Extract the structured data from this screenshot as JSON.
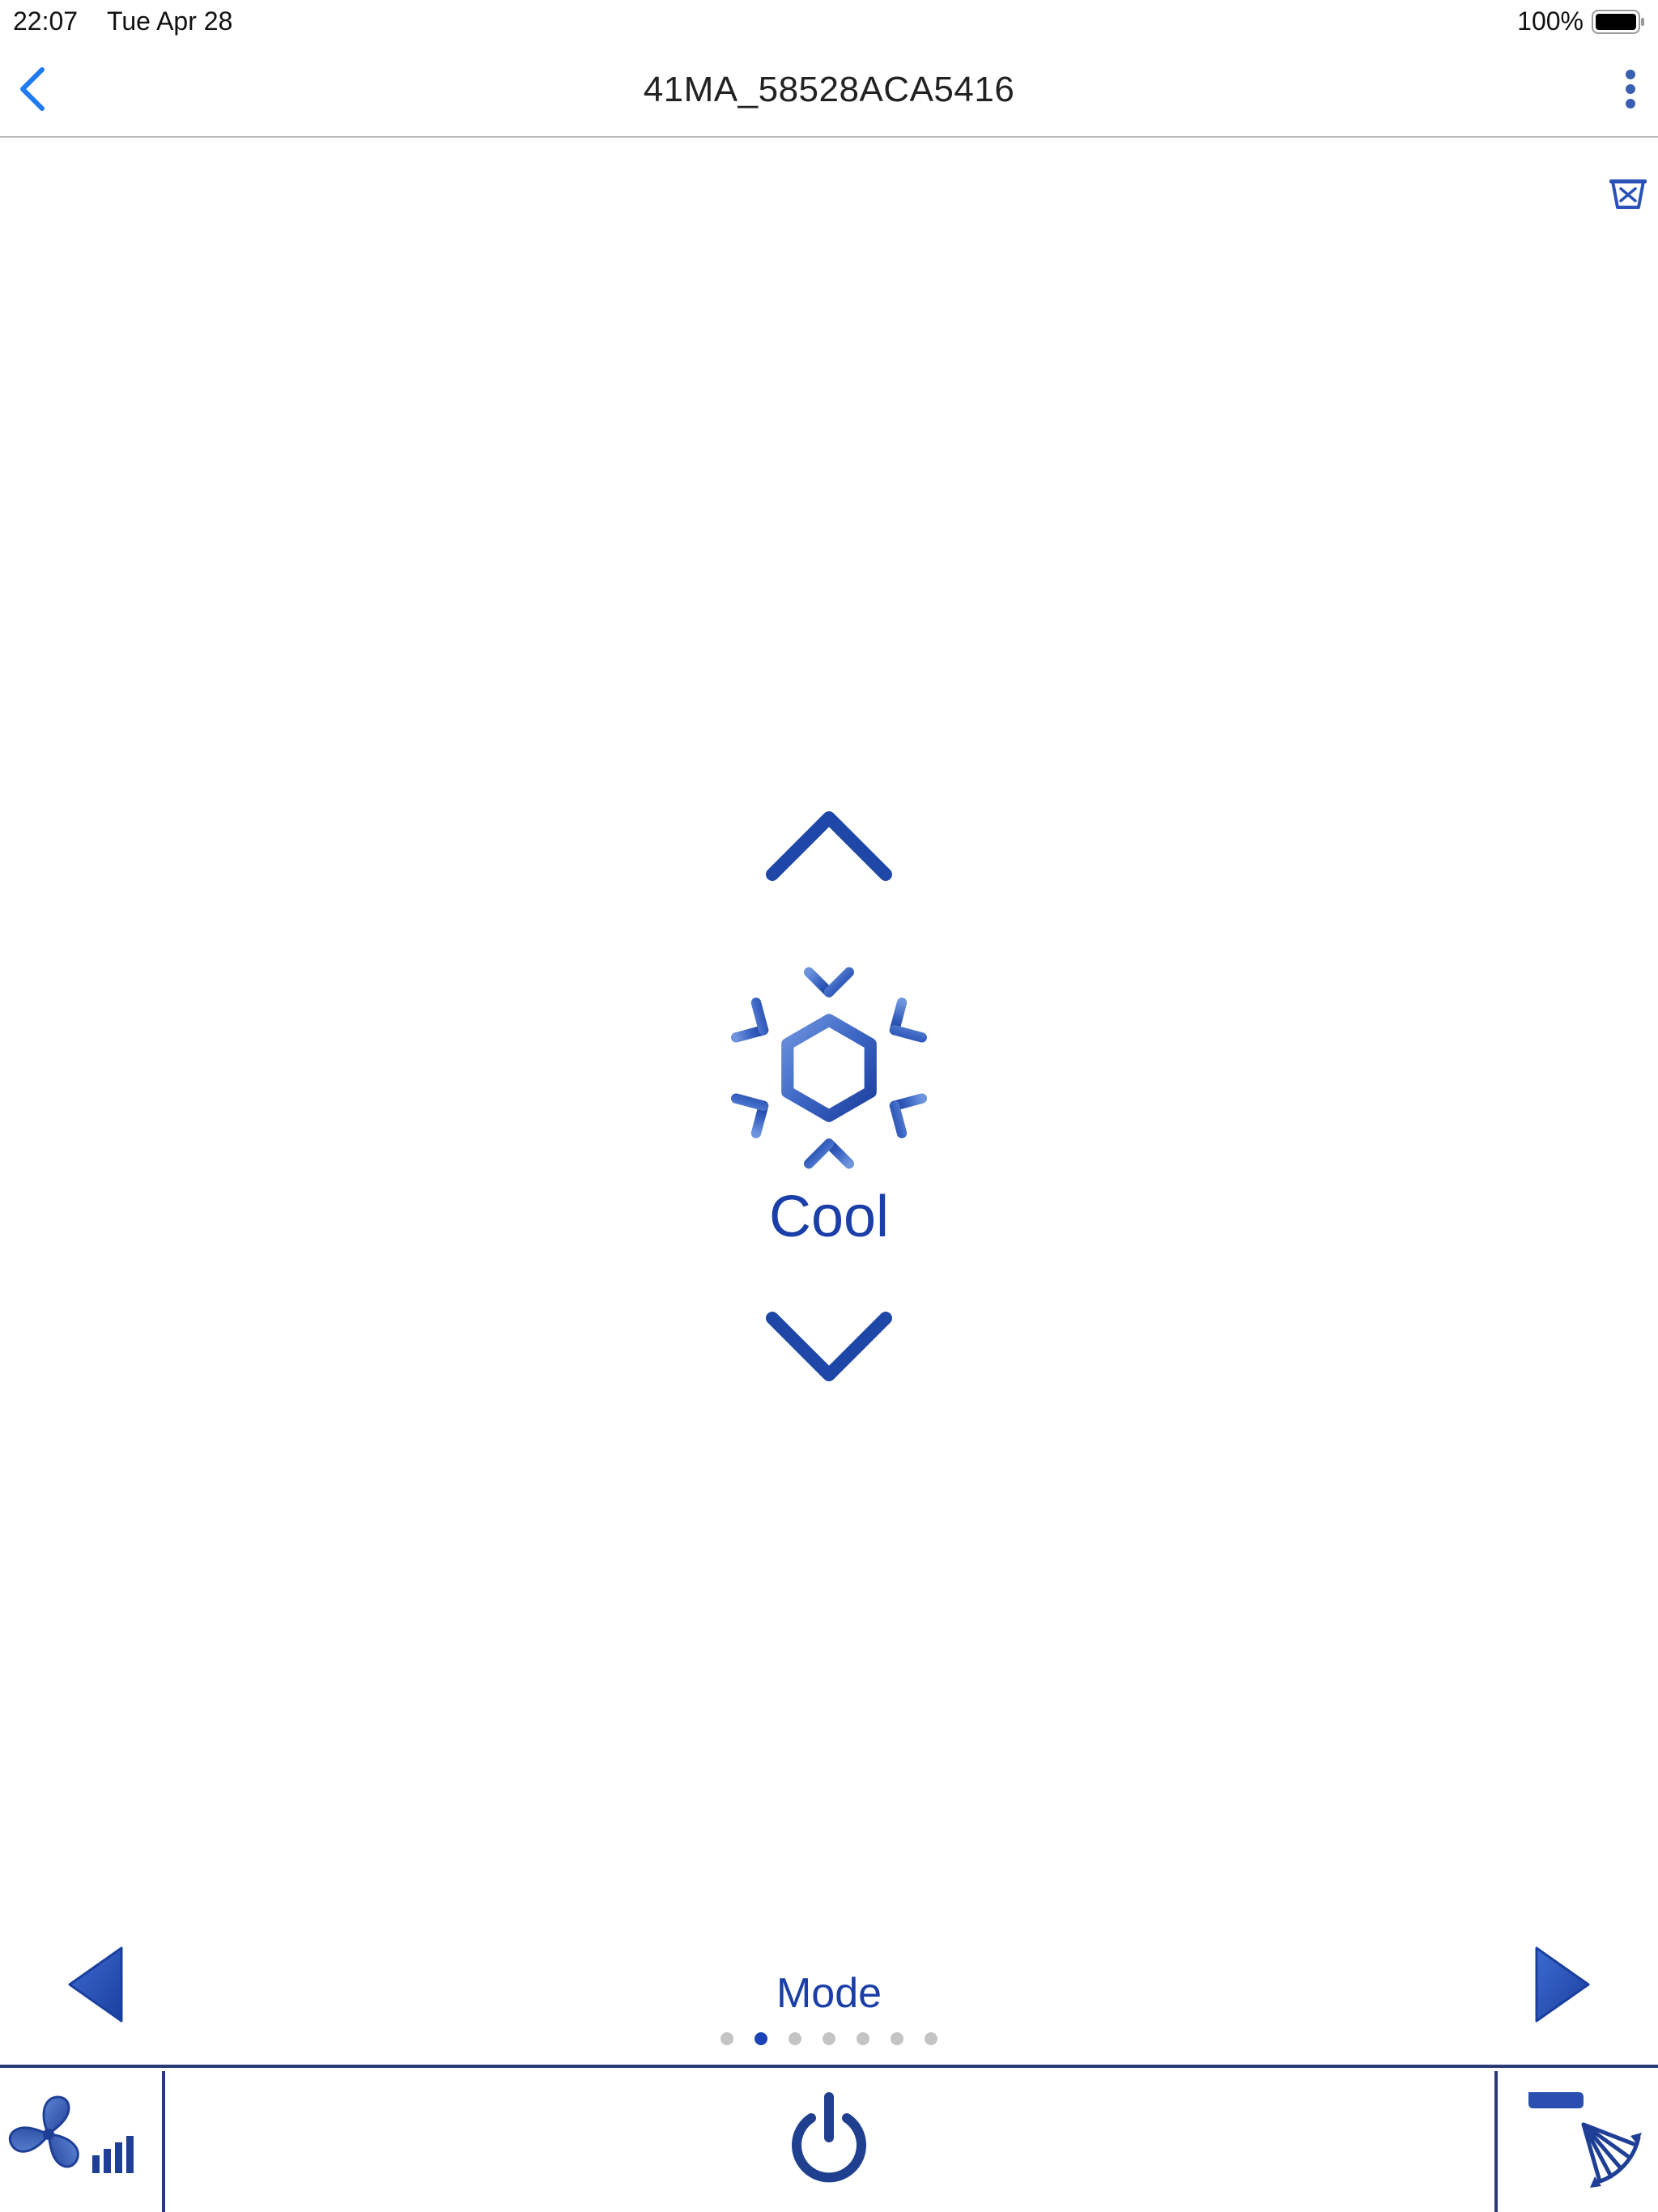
{
  "status_bar": {
    "time": "22:07",
    "date": "Tue Apr 28",
    "battery_text": "100%",
    "battery_level": 1.0
  },
  "nav": {
    "title": "41MA_58528ACA5416",
    "back_icon": "chevron-left-icon",
    "more_icon": "vertical-dots-icon",
    "filter_icon": "filter-icon"
  },
  "mode": {
    "label": "Cool",
    "icon": "snowflake-icon"
  },
  "page": {
    "label": "Mode",
    "dot_count": 7,
    "active_dot": 1
  },
  "bottom_bar": {
    "fan_icon": "fan-speed-icon",
    "power_icon": "power-icon",
    "swing_icon": "swing-icon"
  },
  "colors": {
    "accent": "#1a44b5",
    "mode_text": "#1a3fa8",
    "ios_blue": "#1e7bf2",
    "bar_border": "#2a3a78"
  }
}
